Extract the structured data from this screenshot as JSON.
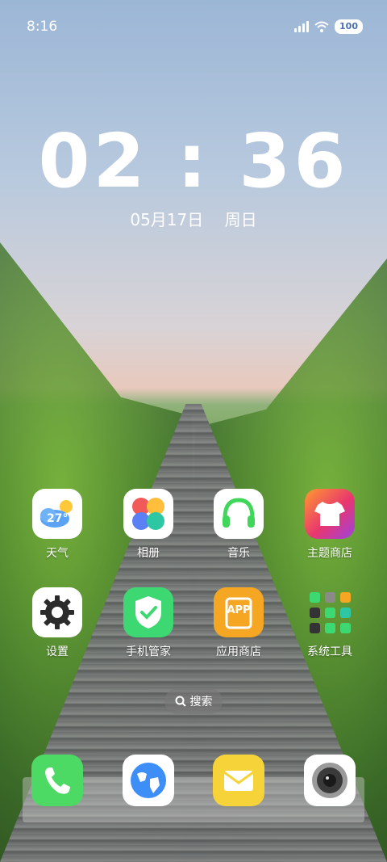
{
  "status_bar": {
    "time": "8:16",
    "battery": "100"
  },
  "lock_clock": {
    "time": "02 : 36",
    "date": "05月17日",
    "weekday": "周日"
  },
  "weather": {
    "temp": "27°"
  },
  "apps": [
    {
      "label": "天气"
    },
    {
      "label": "相册"
    },
    {
      "label": "音乐"
    },
    {
      "label": "主题商店"
    },
    {
      "label": "设置"
    },
    {
      "label": "手机管家"
    },
    {
      "label": "应用商店",
      "badge": "APP"
    },
    {
      "label": "系统工具"
    }
  ],
  "search": {
    "label": "搜索"
  },
  "colors": {
    "phone": "#4cd964",
    "mail": "#f7d33a",
    "security": "#3ed873",
    "store": "#f5a623",
    "theme": "#e8366f"
  }
}
